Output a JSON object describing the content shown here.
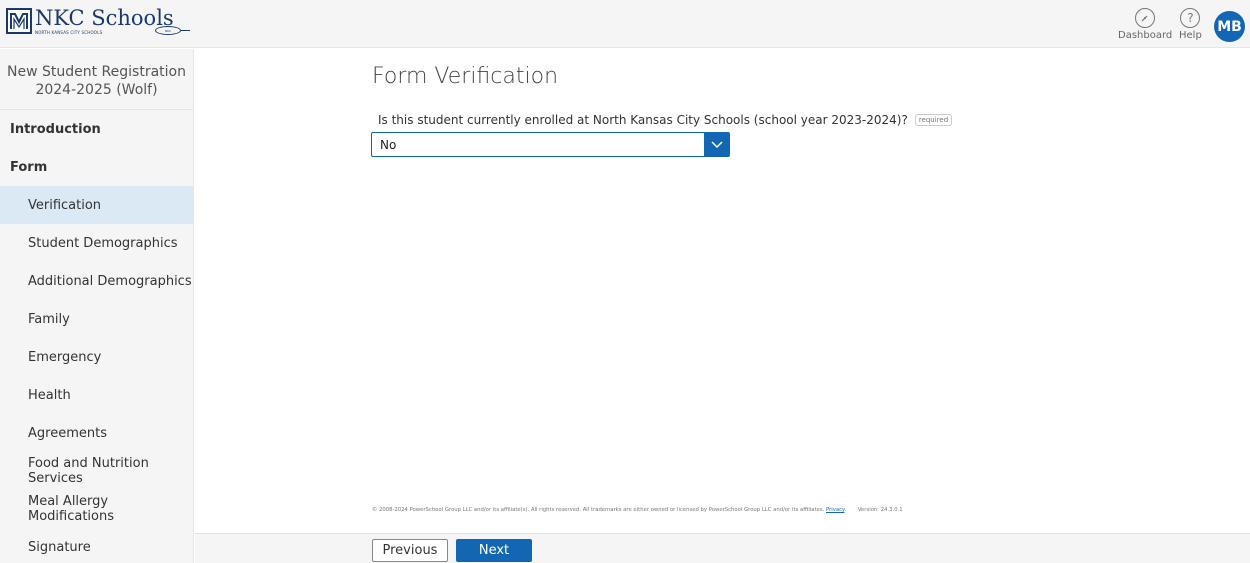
{
  "header": {
    "logo": {
      "name": "NKC Schools",
      "subtitle": "NORTH KANSAS CITY SCHOOLS",
      "badge": "NKC"
    },
    "dashboard_label": "Dashboard",
    "help_label": "Help",
    "avatar_initials": "MB"
  },
  "sidebar": {
    "title_line1": "New Student Registration",
    "title_line2": "2024-2025 (Wolf)",
    "sections": {
      "introduction": "Introduction",
      "form": "Form"
    },
    "items": [
      {
        "label": "Verification",
        "active": true
      },
      {
        "label": "Student Demographics"
      },
      {
        "label": "Additional Demographics"
      },
      {
        "label": "Family"
      },
      {
        "label": "Emergency"
      },
      {
        "label": "Health"
      },
      {
        "label": "Agreements"
      },
      {
        "label": "Food and Nutrition Services"
      },
      {
        "label": "Meal Allergy Modifications"
      },
      {
        "label": "Signature"
      }
    ]
  },
  "main": {
    "title": "Form Verification",
    "question": "Is this student currently enrolled at North Kansas City Schools (school year 2023-2024)?",
    "required_label": "required",
    "select_value": "No"
  },
  "footer": {
    "copyright": "© 2008-2024 PowerSchool Group LLC and/or its affiliate(s). All rights reserved. All trademarks are either owned or licensed by PowerSchool Group LLC and/or its affiliates.",
    "privacy_link": "Privacy",
    "version": "Version: 24.3.0.1"
  },
  "nav": {
    "previous_label": "Previous",
    "next_label": "Next"
  },
  "colors": {
    "accent": "#1266b2",
    "active_item_bg": "#dbe9f4",
    "brand_navy": "#1a3a6e"
  }
}
